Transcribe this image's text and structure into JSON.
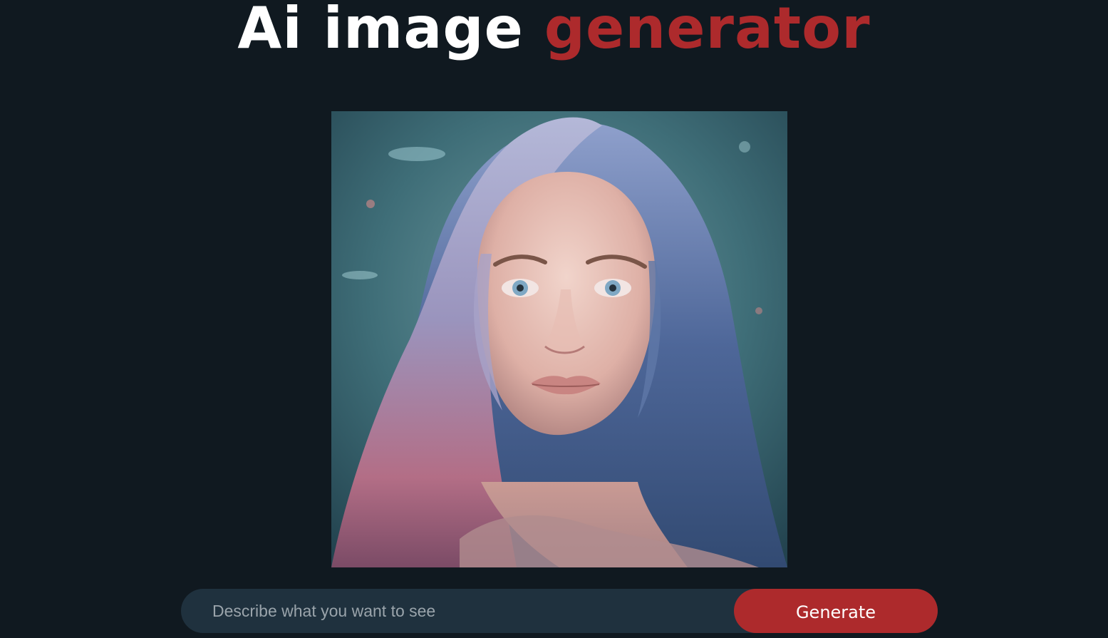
{
  "header": {
    "title_part1": "Ai image ",
    "title_part2": "generator"
  },
  "colors": {
    "background": "#101920",
    "accent": "#ad2a2c",
    "input_background": "#1f313e"
  },
  "prompt": {
    "placeholder": "Describe what you want to see",
    "value": ""
  },
  "buttons": {
    "generate_label": "Generate"
  }
}
